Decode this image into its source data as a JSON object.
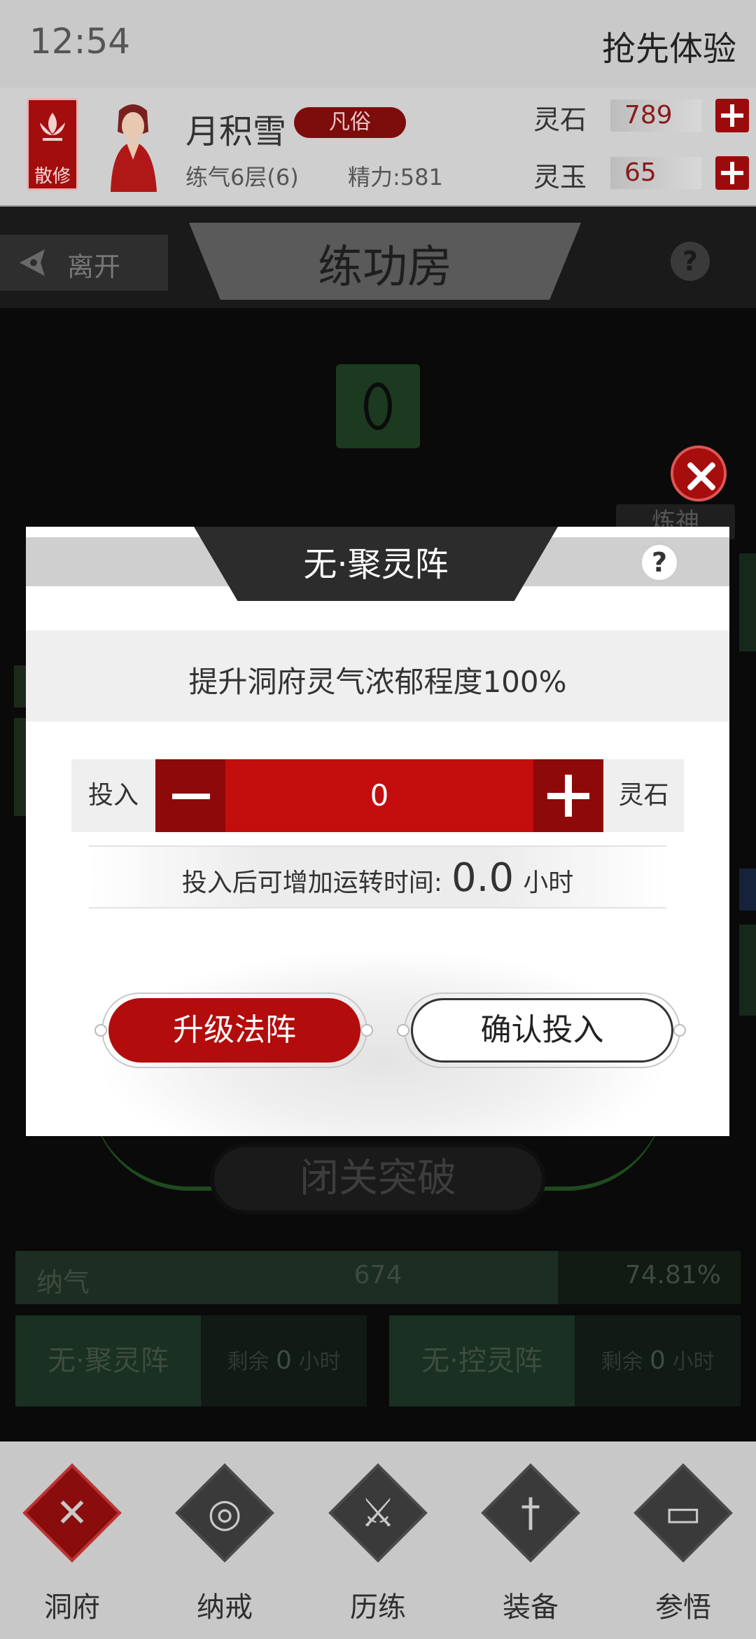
{
  "status_bar": {
    "time": "12:54",
    "right_text": "抢先体验"
  },
  "player": {
    "sect": "散修",
    "name": "月积雪",
    "rank": "凡俗",
    "level": "练气6层(6)",
    "energy": "精力:581"
  },
  "resources": [
    {
      "label": "灵石",
      "value": "789"
    },
    {
      "label": "灵玉",
      "value": "65"
    }
  ],
  "page": {
    "leave": "离开",
    "title": "练功房",
    "help": "?"
  },
  "side_label": "炼神",
  "modal": {
    "title": "无·聚灵阵",
    "help": "?",
    "description": "提升洞府灵气浓郁程度100%",
    "stepper": {
      "left_label": "投入",
      "value": "0",
      "right_label": "灵石"
    },
    "runtime": {
      "label": "投入后可增加运转时间:",
      "value": "0.0",
      "unit": "小时"
    },
    "upgrade_button": "升级法阵",
    "confirm_button": "确认投入"
  },
  "seclude_button": "闭关突破",
  "qi": {
    "label": "纳气",
    "value": "674",
    "percent": "74.81%",
    "fill_fraction": 0.7481
  },
  "arrays": [
    {
      "name": "无·聚灵阵",
      "remain_prefix": "剩余",
      "remain_value": "0",
      "remain_unit": "小时"
    },
    {
      "name": "无·控灵阵",
      "remain_prefix": "剩余",
      "remain_value": "0",
      "remain_unit": "小时"
    }
  ],
  "nav": [
    {
      "label": "洞府",
      "icon": "cross-icon"
    },
    {
      "label": "纳戒",
      "icon": "ring-icon"
    },
    {
      "label": "历练",
      "icon": "crossed-swords-icon"
    },
    {
      "label": "装备",
      "icon": "sword-icon"
    },
    {
      "label": "参悟",
      "icon": "book-icon"
    }
  ]
}
